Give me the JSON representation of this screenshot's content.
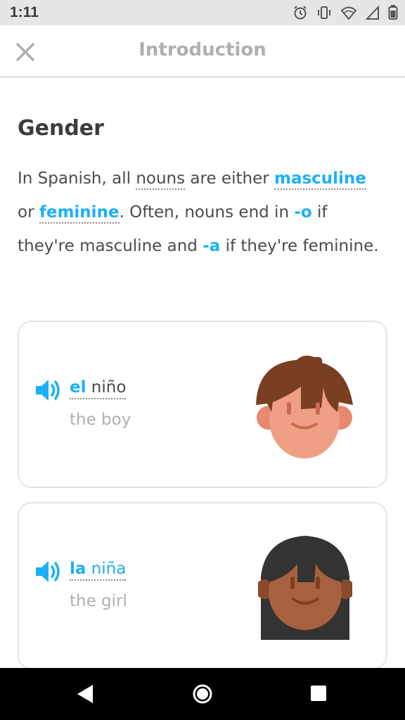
{
  "status_bar": {
    "time": "1:11",
    "icons": [
      "alarm-icon",
      "vibrate-icon",
      "wifi-icon",
      "signal-icon",
      "battery-icon"
    ]
  },
  "header": {
    "title": "Introduction",
    "close_icon": "close-icon"
  },
  "lesson": {
    "heading": "Gender",
    "paragraph": {
      "t1": "In Spanish, all ",
      "nouns": "nouns",
      "t2": " are either ",
      "masculine": "masculine",
      "t3": " or ",
      "feminine": "feminine",
      "t4": ". Often, nouns end in ",
      "o_ending": "-o",
      "t5": " if they're masculine and ",
      "a_ending": "-a",
      "t6": " if they're feminine."
    }
  },
  "cards": [
    {
      "article": "el",
      "noun": " niño",
      "translation": "the boy",
      "audio_icon": "speaker-icon",
      "avatar": "boy-avatar"
    },
    {
      "article": "la",
      "noun": " niña",
      "translation": "the girl",
      "audio_icon": "speaker-icon",
      "avatar": "girl-avatar"
    }
  ],
  "colors": {
    "accent": "#1cb0f6",
    "muted": "#afafaf",
    "text": "#4b4b4b"
  },
  "nav_bar": {
    "icons": [
      "back-icon",
      "home-icon",
      "recents-icon"
    ]
  }
}
